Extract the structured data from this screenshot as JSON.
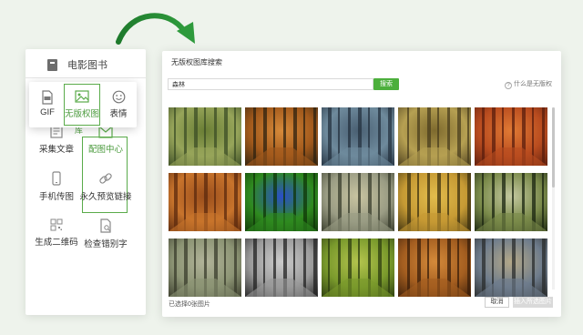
{
  "left_panel": {
    "top_item": {
      "label": "电影图书",
      "icon": "book-icon"
    },
    "popup": [
      {
        "label": "GIF",
        "icon": "gif-file-icon"
      },
      {
        "label": "无版权图",
        "icon": "image-icon",
        "selected": true
      },
      {
        "label": "表情",
        "icon": "smiley-icon"
      }
    ],
    "grid": [
      {
        "label": "采集文章",
        "icon": "article-icon"
      },
      {
        "label": "配图中心",
        "icon": "image-envelope-icon",
        "selected": true,
        "overlay": "库"
      },
      {
        "label": "手机传图",
        "icon": "phone-icon"
      },
      {
        "label": "永久预览链接",
        "icon": "link-icon"
      },
      {
        "label": "生成二维码",
        "icon": "qrcode-icon"
      },
      {
        "label": "检查错别字",
        "icon": "doc-check-icon"
      }
    ]
  },
  "dialog": {
    "title": "无版权图库搜索",
    "search_value": "森林",
    "search_button": "搜索",
    "help_link": "什么是无版权",
    "selected_count": "已选择0张图片",
    "cancel_button": "取消",
    "insert_button": "插入所选图片",
    "thumbnails": [
      {
        "name": "forest-path-green",
        "c1": "#97a55a",
        "c2": "#3c4d25",
        "c3": "#6a7e35"
      },
      {
        "name": "autumn-forest-orange",
        "c1": "#a35a1c",
        "c2": "#2e2210",
        "c3": "#d68a3a"
      },
      {
        "name": "blue-misty-forest",
        "c1": "#6e8a9c",
        "c2": "#24313f",
        "c3": "#4a6073"
      },
      {
        "name": "sunlit-forest-yellow",
        "c1": "#b6a052",
        "c2": "#4a3d1d",
        "c3": "#7e6a2e"
      },
      {
        "name": "red-autumn-forest",
        "c1": "#b94c1f",
        "c2": "#5a1e0e",
        "c3": "#e07a34"
      },
      {
        "name": "autumn-orange-trees",
        "c1": "#c8742c",
        "c2": "#5c2a0e",
        "c3": "#9a4e1c"
      },
      {
        "name": "blue-flower",
        "c1": "#2f8a1f",
        "c2": "#0f3508",
        "c3": "#2a4ec8"
      },
      {
        "name": "misty-forest-person",
        "c1": "#9a9c84",
        "c2": "#383c2c",
        "c3": "#c8c4a0"
      },
      {
        "name": "golden-autumn-trees",
        "c1": "#c69a34",
        "c2": "#3e3210",
        "c3": "#e2bc4c"
      },
      {
        "name": "sunbeam-forest",
        "c1": "#7a8a4a",
        "c2": "#1a2410",
        "c3": "#c4c8a0"
      },
      {
        "name": "foggy-forest-road",
        "c1": "#8c9474",
        "c2": "#3a3c2c",
        "c3": "#b2b49a"
      },
      {
        "name": "black-white-fog",
        "c1": "#9a9a9a",
        "c2": "#222222",
        "c3": "#cccccc"
      },
      {
        "name": "green-forest-path",
        "c1": "#7a9a2c",
        "c2": "#2c3c10",
        "c3": "#b4c44e"
      },
      {
        "name": "autumn-forest-path",
        "c1": "#a45e20",
        "c2": "#3a1e0a",
        "c3": "#d48a3a"
      },
      {
        "name": "people-in-forest",
        "c1": "#6e7c8c",
        "c2": "#2a2c2c",
        "c3": "#b4a888"
      }
    ]
  },
  "colors": {
    "accent_green": "#4caf3c",
    "background": "#eef3ec"
  }
}
